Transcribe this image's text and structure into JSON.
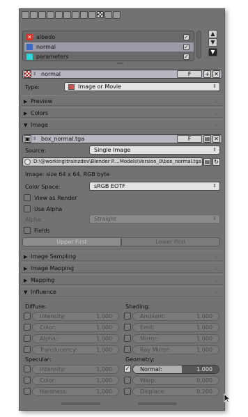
{
  "colors": {
    "panel_bg": "#727272",
    "selection": "#9c9aa6",
    "albedo_swatch": "#e03020",
    "normal_swatch": "#3a6ac8",
    "parameters_swatch": "#28d8d8"
  },
  "header_tabs": [
    "render-icon",
    "render-layers-icon",
    "scene-icon",
    "world-icon",
    "object-icon",
    "constraints-icon",
    "modifiers-icon",
    "data-icon",
    "material-icon",
    "texture-icon",
    "particles-icon",
    "physics-icon"
  ],
  "texture_slots": [
    {
      "label": "albedo",
      "icon": "x-box-icon",
      "checked": true
    },
    {
      "label": "normal",
      "icon": "color-swatch-icon",
      "checked": true,
      "selected": true
    },
    {
      "label": "parameters",
      "icon": "color-swatch-icon",
      "checked": true
    }
  ],
  "texture": {
    "name": "normal",
    "fake_user": "F"
  },
  "type": {
    "label": "Type:",
    "value": "Image or Movie"
  },
  "sections": {
    "preview": "Preview",
    "colors": "Colors",
    "image": "Image",
    "image_sampling": "Image Sampling",
    "image_mapping": "Image Mapping",
    "mapping": "Mapping",
    "influence": "Influence"
  },
  "image": {
    "name": "box_normal.tga",
    "fake_user": "F",
    "source_label": "Source:",
    "source_value": "Single Image",
    "path": "D:\\@working\\trainzdev\\Blender P....Models\\Version_0\\box_normal.tga",
    "info": "Image: size 64 x 64, RGB byte",
    "color_space_label": "Color Space:",
    "color_space_value": "sRGB EOTF",
    "view_as_render": "View as Render",
    "use_alpha": "Use Alpha",
    "alpha_label": "Alpha:",
    "alpha_value": "Straight",
    "fields": "Fields",
    "upper_first": "Upper First",
    "lower_first": "Lower First"
  },
  "influence": {
    "diffuse_title": "Diffuse:",
    "diffuse": [
      {
        "label": "Intensity:",
        "value": "1.000"
      },
      {
        "label": "Color:",
        "value": "1.000"
      },
      {
        "label": "Alpha:",
        "value": "1.000"
      },
      {
        "label": "Translucency:",
        "value": "1.000"
      }
    ],
    "shading_title": "Shading:",
    "shading": [
      {
        "label": "Ambient:",
        "value": "1.000"
      },
      {
        "label": "Emit:",
        "value": "1.000"
      },
      {
        "label": "Mirror:",
        "value": "1.000"
      },
      {
        "label": "Ray Mirror:",
        "value": "1.000"
      }
    ],
    "specular_title": "Specular:",
    "specular": [
      {
        "label": "Intensity:",
        "value": "1.000"
      },
      {
        "label": "Color:",
        "value": "1.000"
      },
      {
        "label": "Hardness:",
        "value": "1.000"
      }
    ],
    "geometry_title": "Geometry:",
    "geometry": [
      {
        "label": "Normal:",
        "value": "1.000",
        "enabled": true,
        "fill": 0.57
      },
      {
        "label": "Warp:",
        "value": "0.000"
      },
      {
        "label": "Displace:",
        "value": "0.200"
      }
    ]
  }
}
